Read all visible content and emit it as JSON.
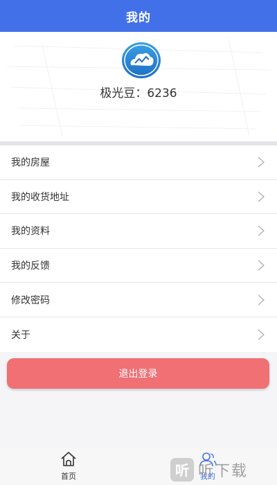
{
  "header": {
    "title": "我的"
  },
  "profile": {
    "beans_text": "极光豆：6236"
  },
  "menu": {
    "items": [
      {
        "label": "我的房屋"
      },
      {
        "label": "我的收货地址"
      },
      {
        "label": "我的资料"
      },
      {
        "label": "我的反馈"
      },
      {
        "label": "修改密码"
      },
      {
        "label": "关于"
      }
    ]
  },
  "logout": {
    "label": "退出登录"
  },
  "tabbar": {
    "tabs": [
      {
        "label": "首页",
        "icon": "home-icon",
        "active": false
      },
      {
        "label": "我的",
        "icon": "user-icon",
        "active": true
      }
    ]
  },
  "watermark": {
    "logo_char": "听",
    "text": "听下载"
  },
  "colors": {
    "primary": "#4270e8",
    "logout": "#f07074",
    "text": "#333333",
    "background": "#f5f5f7"
  }
}
